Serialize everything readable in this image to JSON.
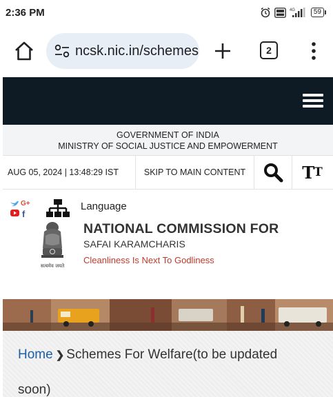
{
  "status_bar": {
    "time": "2:36 PM",
    "network": "4G",
    "battery": "59"
  },
  "browser": {
    "url": "ncsk.nic.in/schemes",
    "tab_count": "2",
    "icons": [
      "home-icon",
      "site-settings-icon",
      "new-tab-icon",
      "tabs-icon",
      "overflow-menu-icon"
    ]
  },
  "site": {
    "header_bg": "#0e1a24",
    "gov_line1": "GOVERNMENT OF INDIA",
    "gov_line2": "MINISTRY OF SOCIAL JUSTICE AND EMPOWERMENT",
    "datetime": "AUG 05, 2024 | 13:48:29 IST",
    "skip_link": "SKIP TO MAIN CONTENT",
    "text_size_big": "T",
    "text_size_small": "T",
    "language_label": "Language",
    "org_name": "NATIONAL COMMISSION FOR",
    "org_sub": "SAFAI KARAMCHARIS",
    "tagline": "Cleanliness Is Next To Godliness",
    "emblem_motto": "सत्यमेव जयते",
    "tagline_color": "#c0392b"
  },
  "breadcrumb": {
    "home": "Home",
    "separator": "❯",
    "current_line1": "Schemes For Welfare(to be updated",
    "current_line2": "soon)",
    "link_color": "#1a5fa8"
  }
}
